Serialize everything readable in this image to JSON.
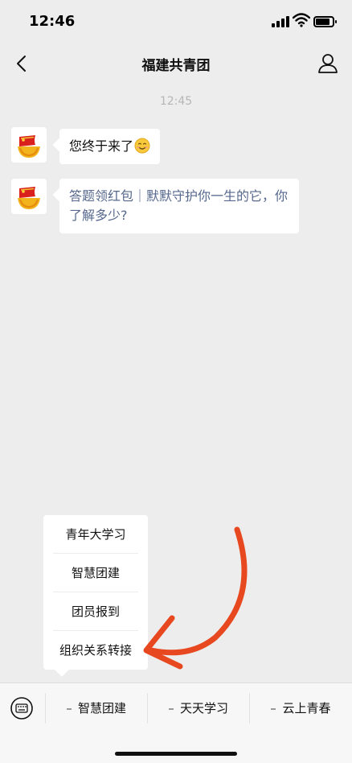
{
  "status_bar": {
    "time": "12:46",
    "battery_level": 0.85
  },
  "nav": {
    "title": "福建共青团"
  },
  "chat": {
    "timestamp": "12:45",
    "messages": [
      {
        "text": "您终于来了",
        "emoji": "smiling-face-emoji"
      },
      {
        "text": "答题领红包｜默默守护你一生的它，你了解多少?"
      }
    ]
  },
  "popup_menu": {
    "items": [
      "青年大学习",
      "智慧团建",
      "团员报到",
      "组织关系转接"
    ]
  },
  "bottom_menu": {
    "tabs": [
      "智慧团建",
      "天天学习",
      "云上青春"
    ]
  },
  "icons": {
    "back": "chevron-left-icon",
    "profile": "person-icon",
    "keyboard": "keyboard-icon",
    "avatar": "youth-league-emblem-icon"
  },
  "colors": {
    "background": "#ededed",
    "link_text": "#56688e",
    "annotation_arrow": "#e8481f"
  }
}
